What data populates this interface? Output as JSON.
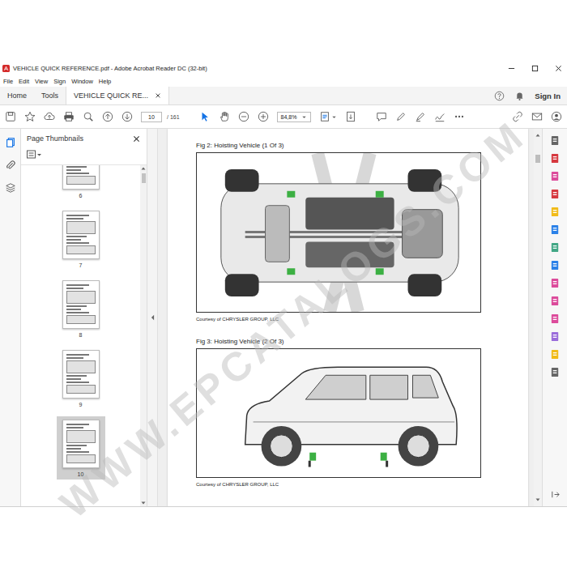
{
  "window": {
    "title": "VEHICLE QUICK REFERENCE.pdf - Adobe Acrobat Reader DC (32-bit)"
  },
  "menu": [
    "File",
    "Edit",
    "View",
    "Sign",
    "Window",
    "Help"
  ],
  "tabs": [
    {
      "label": "Home",
      "selected": false
    },
    {
      "label": "Tools",
      "selected": false
    },
    {
      "label": "VEHICLE QUICK RE...",
      "selected": true
    }
  ],
  "account": {
    "sign_in": "Sign In"
  },
  "toolbar": {
    "page": "10",
    "page_total": "/ 161",
    "zoom": "84,8%"
  },
  "thumbnails": {
    "title": "Page Thumbnails",
    "pages": [
      {
        "label": "6",
        "selected": false
      },
      {
        "label": "7",
        "selected": false
      },
      {
        "label": "8",
        "selected": false
      },
      {
        "label": "9",
        "selected": false
      },
      {
        "label": "10",
        "selected": true
      }
    ]
  },
  "document": {
    "figures": [
      {
        "caption": "Fig 2: Hoisting Vehicle (1 Of 3)",
        "kind": "underbody",
        "credit": "Courtesy of CHRYSLER GROUP, LLC"
      },
      {
        "caption": "Fig 3: Hoisting Vehicle (2 Of 3)",
        "kind": "side",
        "credit": "Courtesy of CHRYSLER GROUP, LLC"
      }
    ]
  },
  "watermark": "WWW.EPCATALOGS.COM"
}
